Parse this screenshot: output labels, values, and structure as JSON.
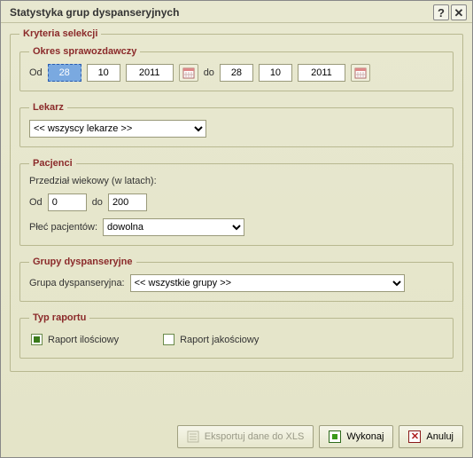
{
  "window": {
    "title": "Statystyka grup dyspanseryjnych"
  },
  "criteria": {
    "legend": "Kryteria selekcji"
  },
  "period": {
    "legend": "Okres sprawozdawczy",
    "from_label": "Od",
    "to_label": "do",
    "from": {
      "day": "28",
      "month": "10",
      "year": "2011"
    },
    "to": {
      "day": "28",
      "month": "10",
      "year": "2011"
    }
  },
  "doctor": {
    "legend": "Lekarz",
    "selected": "<< wszyscy lekarze >>"
  },
  "patients": {
    "legend": "Pacjenci",
    "age_label": "Przedział wiekowy (w latach):",
    "from_label": "Od",
    "to_label": "do",
    "age_from": "0",
    "age_to": "200",
    "gender_label": "Płeć pacjentów:",
    "gender_selected": "dowolna"
  },
  "groups": {
    "legend": "Grupy dyspanseryjne",
    "label": "Grupa dyspanseryjna:",
    "selected": "<< wszystkie grupy >>"
  },
  "reportType": {
    "legend": "Typ raportu",
    "quantitative": "Raport ilościowy",
    "qualitative": "Raport jakościowy",
    "quantitative_checked": true,
    "qualitative_checked": false
  },
  "buttons": {
    "export": "Eksportuj dane do XLS",
    "run": "Wykonaj",
    "cancel": "Anuluj"
  }
}
